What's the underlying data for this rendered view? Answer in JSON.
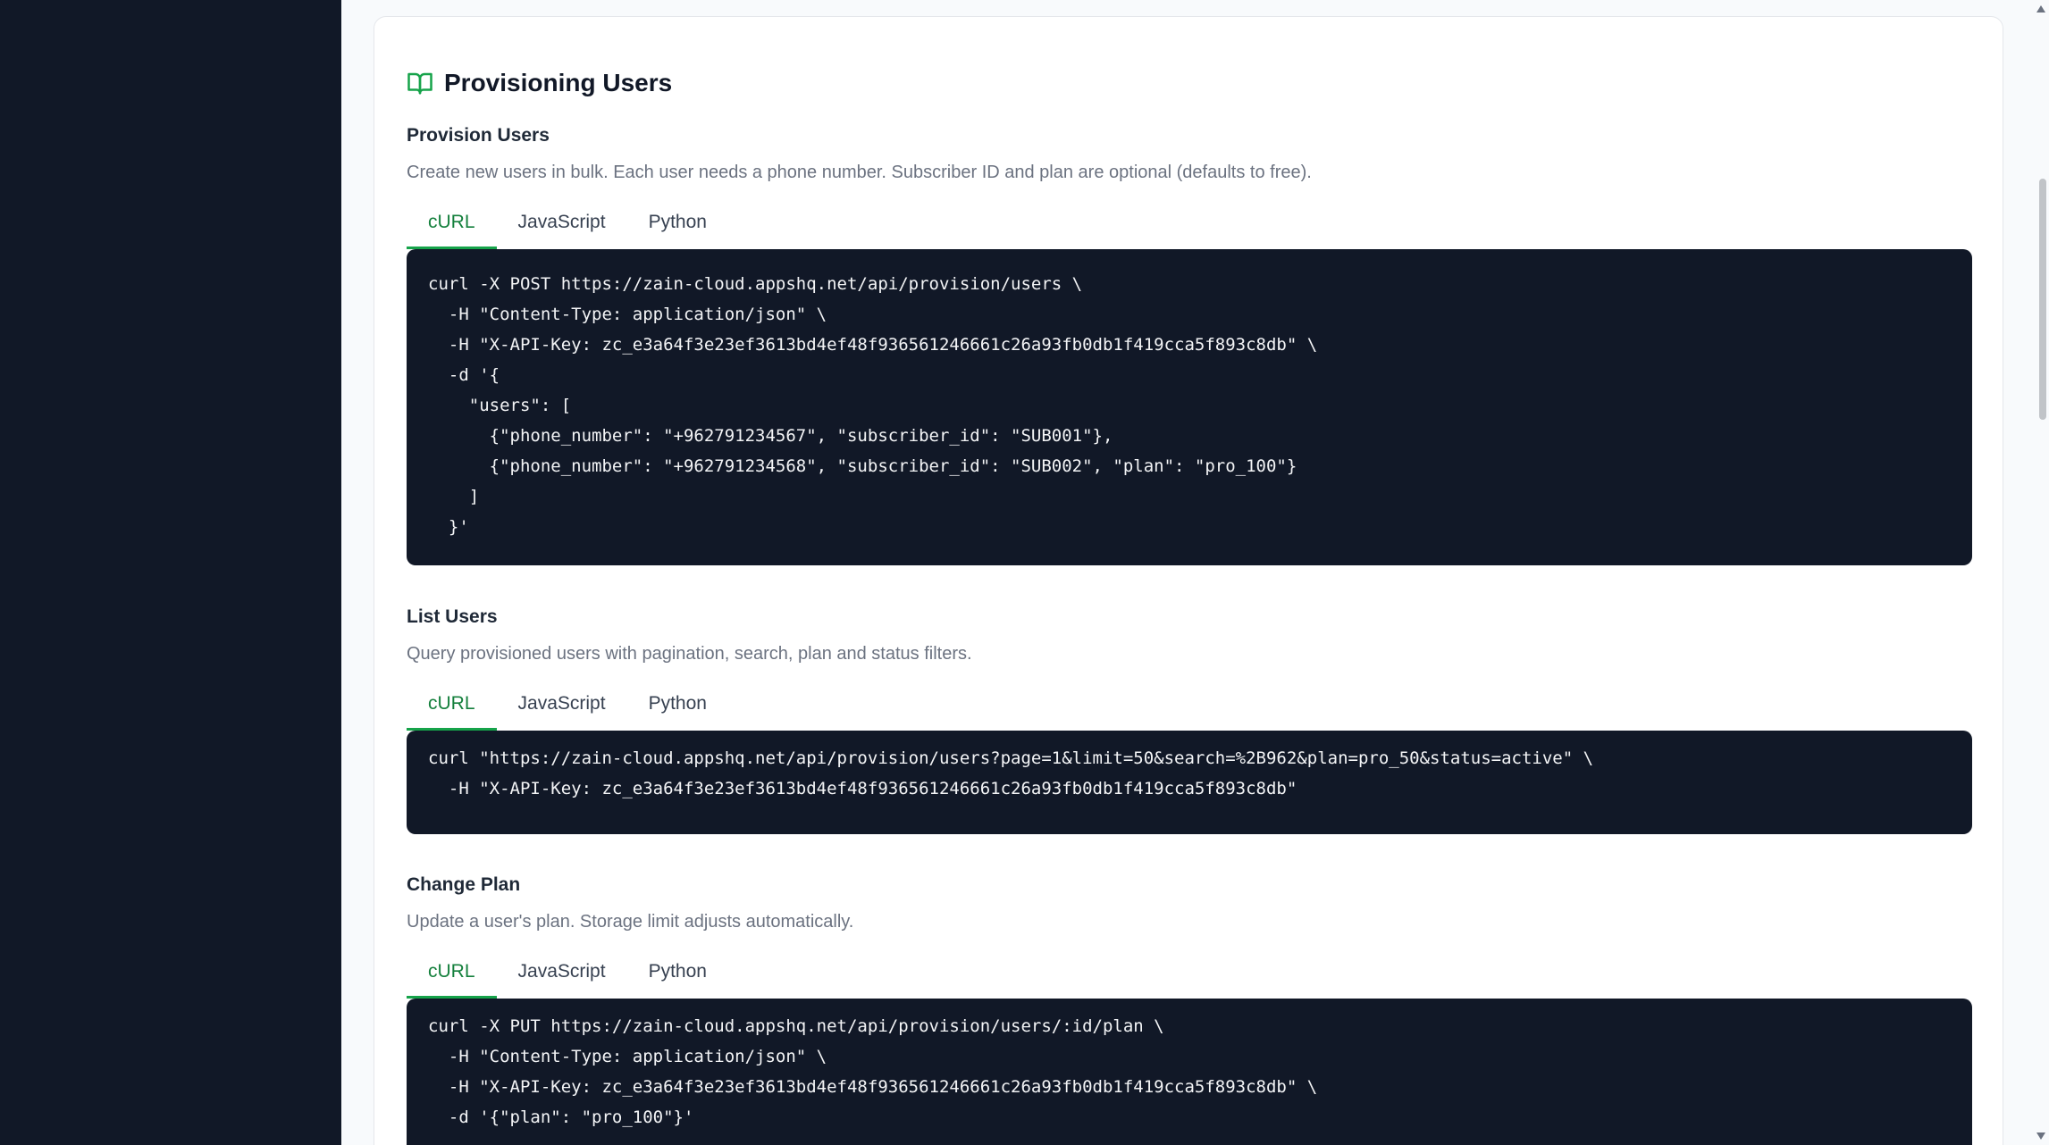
{
  "card": {
    "title": "Provisioning Users"
  },
  "sections": [
    {
      "title": "Provision Users",
      "description": "Create new users in bulk. Each user needs a phone number. Subscriber ID and plan are optional (defaults to free).",
      "tabs": [
        "cURL",
        "JavaScript",
        "Python"
      ],
      "active_tab": "cURL",
      "code": "curl -X POST https://zain-cloud.appshq.net/api/provision/users \\\n  -H \"Content-Type: application/json\" \\\n  -H \"X-API-Key: zc_e3a64f3e23ef3613bd4ef48f936561246661c26a93fb0db1f419cca5f893c8db\" \\\n  -d '{\n    \"users\": [\n      {\"phone_number\": \"+962791234567\", \"subscriber_id\": \"SUB001\"},\n      {\"phone_number\": \"+962791234568\", \"subscriber_id\": \"SUB002\", \"plan\": \"pro_100\"}\n    ]\n  }'"
    },
    {
      "title": "List Users",
      "description": "Query provisioned users with pagination, search, plan and status filters.",
      "tabs": [
        "cURL",
        "JavaScript",
        "Python"
      ],
      "active_tab": "cURL",
      "code": "curl \"https://zain-cloud.appshq.net/api/provision/users?page=1&limit=50&search=%2B962&plan=pro_50&status=active\" \\\n  -H \"X-API-Key: zc_e3a64f3e23ef3613bd4ef48f936561246661c26a93fb0db1f419cca5f893c8db\""
    },
    {
      "title": "Change Plan",
      "description": "Update a user's plan. Storage limit adjusts automatically.",
      "tabs": [
        "cURL",
        "JavaScript",
        "Python"
      ],
      "active_tab": "cURL",
      "code": "curl -X PUT https://zain-cloud.appshq.net/api/provision/users/:id/plan \\\n  -H \"Content-Type: application/json\" \\\n  -H \"X-API-Key: zc_e3a64f3e23ef3613bd4ef48f936561246661c26a93fb0db1f419cca5f893c8db\" \\\n  -d '{\"plan\": \"pro_100\"}'"
    }
  ],
  "icons": {
    "header": "book-open-icon"
  },
  "colors": {
    "accent": "#16a34a",
    "sidebar": "#111827",
    "code_bg": "#111827"
  }
}
